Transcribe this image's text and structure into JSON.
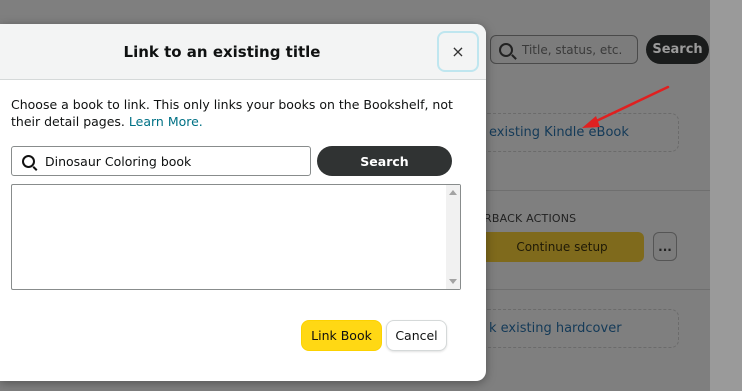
{
  "background": {
    "search_placeholder": "Title, status, etc.",
    "search_button": "Search",
    "link_kindle": "existing Kindle eBook",
    "actions_label": "RBACK ACTIONS",
    "continue_button": "Continue setup",
    "more_button": "...",
    "link_hardcover": "k existing hardcover",
    "annotation_arrow_color": "#e02020"
  },
  "modal": {
    "title": "Link to an existing title",
    "close_label": "×",
    "description": "Choose a book to link. This only links your books on the Bookshelf, not their detail pages.",
    "learn_more": "Learn More.",
    "search_value": "Dinosaur Coloring book",
    "search_button": "Search",
    "link_book_button": "Link Book",
    "cancel_button": "Cancel"
  },
  "colors": {
    "primary_yellow": "#ffd814",
    "dark_button": "#303333",
    "link_teal": "#007185"
  }
}
